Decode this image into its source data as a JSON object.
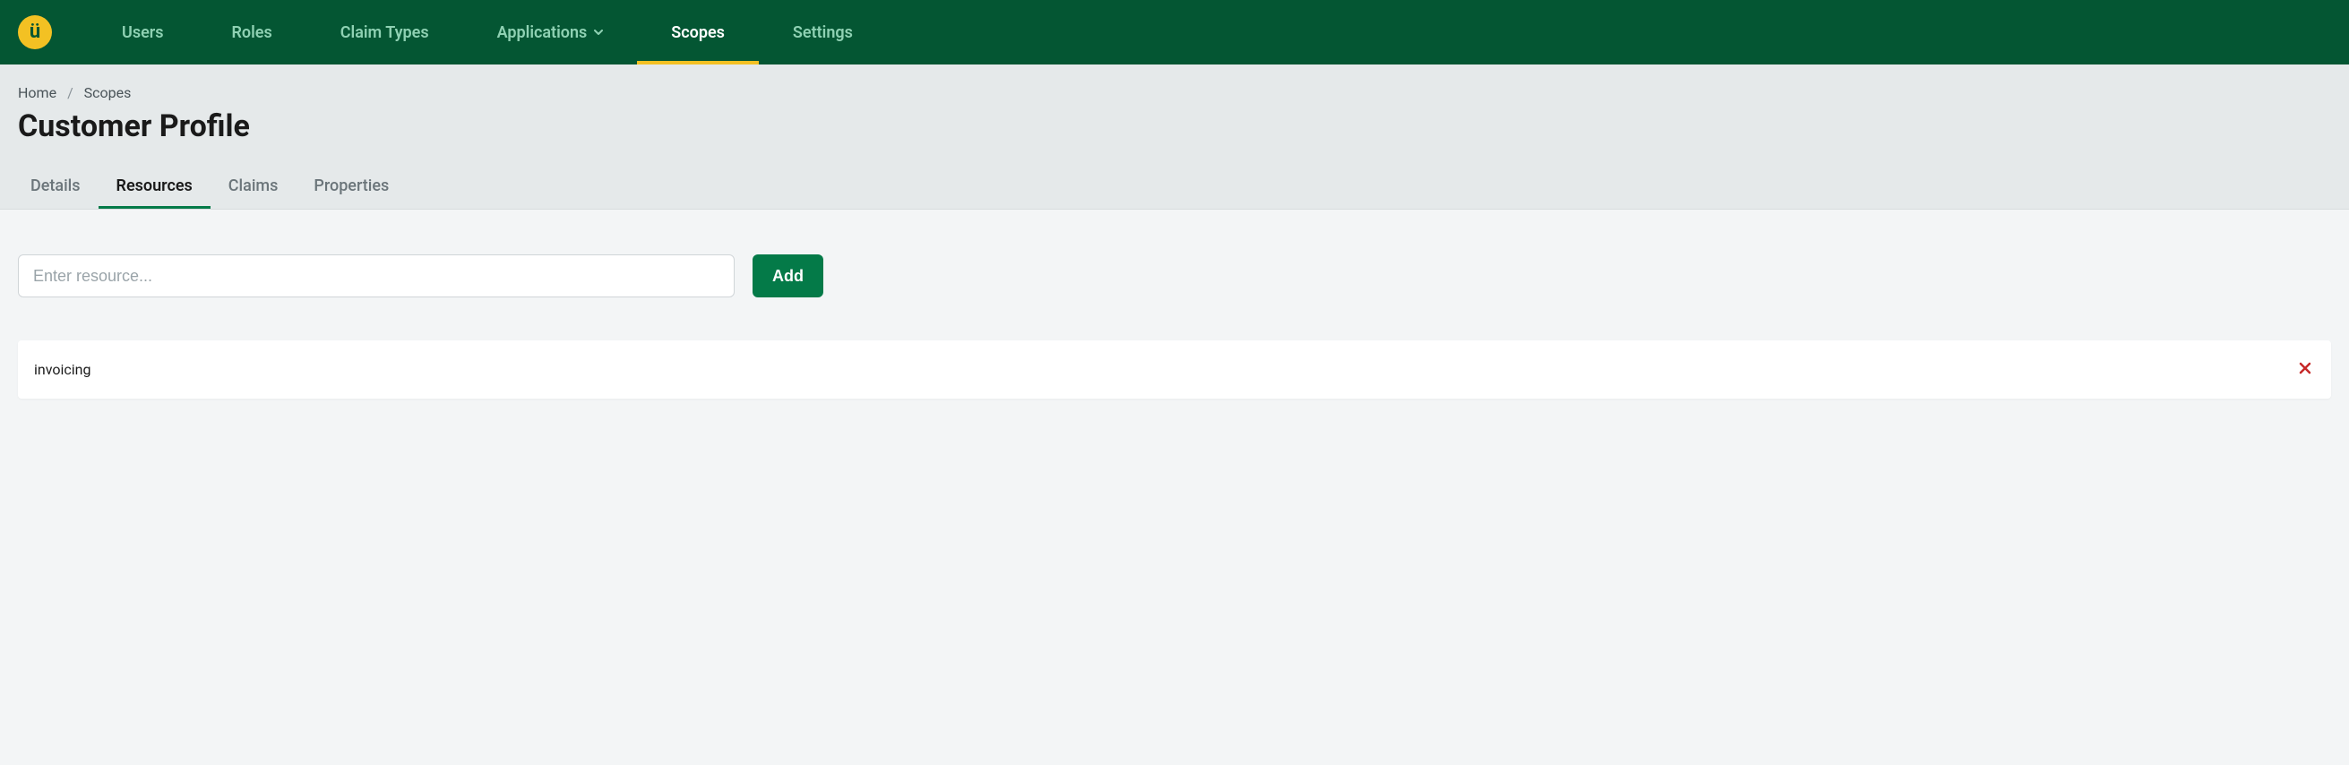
{
  "nav": {
    "items": [
      {
        "label": "Users",
        "active": false,
        "dropdown": false
      },
      {
        "label": "Roles",
        "active": false,
        "dropdown": false
      },
      {
        "label": "Claim Types",
        "active": false,
        "dropdown": false
      },
      {
        "label": "Applications",
        "active": false,
        "dropdown": true
      },
      {
        "label": "Scopes",
        "active": true,
        "dropdown": false
      },
      {
        "label": "Settings",
        "active": false,
        "dropdown": false
      }
    ]
  },
  "breadcrumb": {
    "items": [
      {
        "label": "Home"
      },
      {
        "label": "Scopes"
      }
    ]
  },
  "page": {
    "title": "Customer Profile"
  },
  "tabs": {
    "items": [
      {
        "label": "Details",
        "active": false
      },
      {
        "label": "Resources",
        "active": true
      },
      {
        "label": "Claims",
        "active": false
      },
      {
        "label": "Properties",
        "active": false
      }
    ]
  },
  "form": {
    "resource_placeholder": "Enter resource...",
    "add_label": "Add"
  },
  "resources": {
    "items": [
      {
        "name": "invoicing"
      }
    ]
  }
}
